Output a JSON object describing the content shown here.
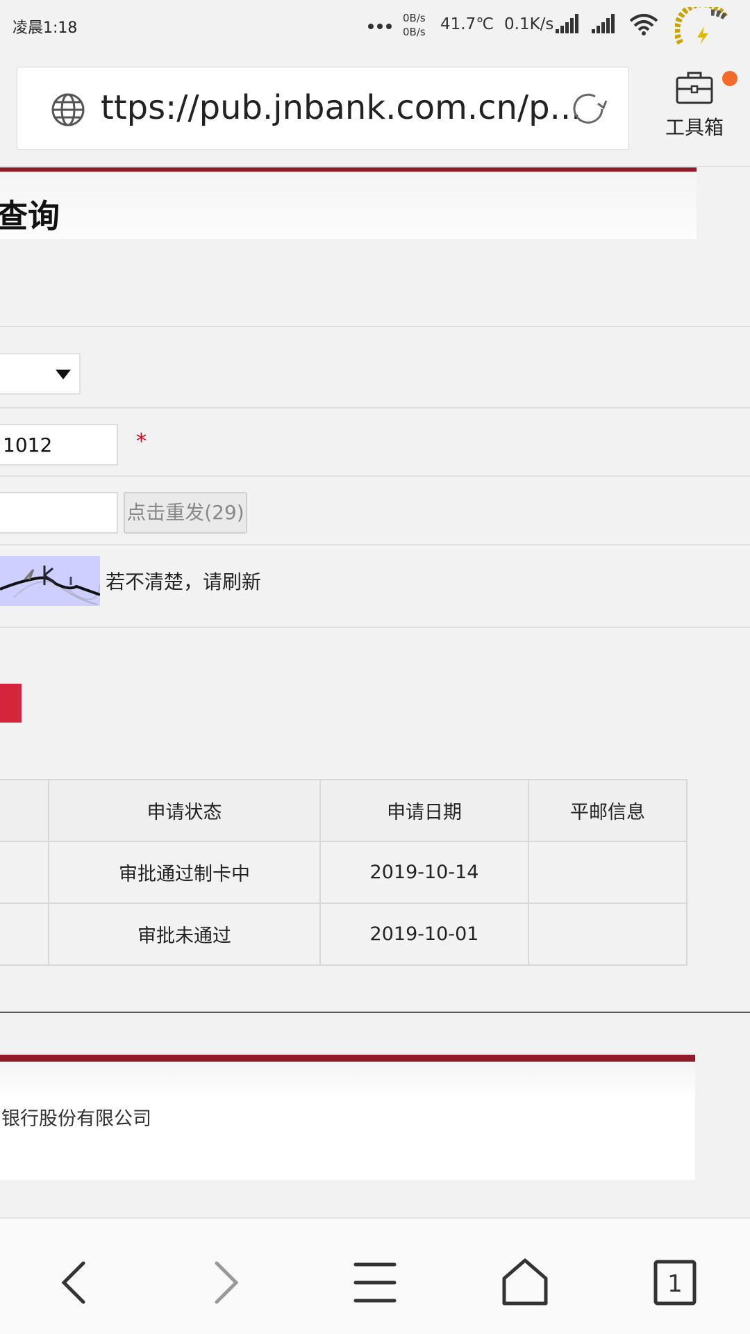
{
  "status_bar": {
    "time": "凌晨1:18",
    "upload_speed": "0B/s",
    "download_speed": "0B/s",
    "temperature": "41.7℃",
    "net_speed": "0.1K/s",
    "icons": [
      "dots-icon",
      "signal-icon",
      "signal-icon",
      "wifi-icon",
      "battery-charging-icon"
    ]
  },
  "browser": {
    "url": "ttps://pub.jnbank.com.cn/p...",
    "toolbox_label": "工具箱",
    "badge_color": "#f26b2a"
  },
  "page": {
    "title": "查询",
    "card_suffix": "1012",
    "required_mark": "*",
    "resend_label": "点击重发(29)",
    "captcha_hint": "若不清楚，请刷新",
    "accent_color": "#d4253d",
    "table": {
      "headers": [
        "申请状态",
        "申请日期",
        "平邮信息"
      ],
      "rows": [
        {
          "status": "审批通过制卡中",
          "date": "2019-10-14",
          "mail": ""
        },
        {
          "status": "审批未通过",
          "date": "2019-10-01",
          "mail": ""
        }
      ]
    },
    "footer_text": "银行股份有限公司"
  },
  "bottom_nav": {
    "tab_count": "1",
    "icons": [
      "back-arrow-icon",
      "forward-arrow-icon",
      "menu-icon",
      "home-icon",
      "tabs-icon"
    ]
  }
}
